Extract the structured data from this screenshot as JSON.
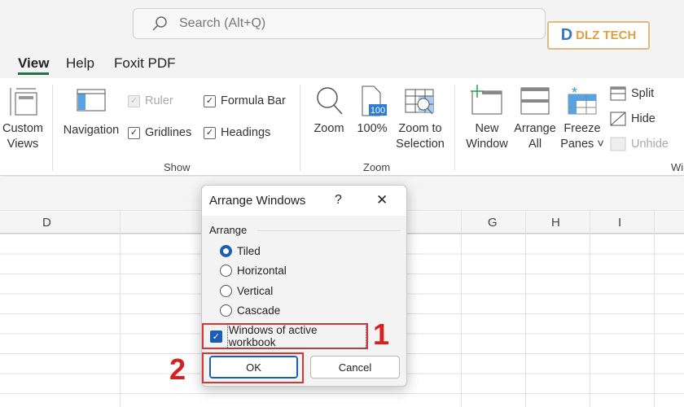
{
  "search": {
    "placeholder": "Search (Alt+Q)",
    "icon": "search-icon"
  },
  "logo": {
    "text": "DLZ TECH",
    "mark": "D"
  },
  "tabs": [
    {
      "label": "View",
      "active": true
    },
    {
      "label": "Help"
    },
    {
      "label": "Foxit PDF"
    }
  ],
  "ribbon": {
    "custom_views": [
      "Custom",
      "Views"
    ],
    "navigation": "Navigation",
    "show": {
      "ruler": "Ruler",
      "formula_bar": "Formula Bar",
      "gridlines": "Gridlines",
      "headings": "Headings",
      "group": "Show"
    },
    "zoom": {
      "zoom": "Zoom",
      "hundred": "100%",
      "hundred_badge": "100",
      "zoom_sel": [
        "Zoom to",
        "Selection"
      ],
      "group": "Zoom"
    },
    "window": {
      "new_window": [
        "New",
        "Window"
      ],
      "arrange_all": [
        "Arrange",
        "All"
      ],
      "freeze": [
        "Freeze",
        "Panes ˅"
      ],
      "split": "Split",
      "hide": "Hide",
      "unhide": "Unhide",
      "group": "Wi"
    }
  },
  "columns": [
    "D",
    "G",
    "H",
    "I"
  ],
  "dialog": {
    "title": "Arrange Windows",
    "help": "?",
    "close": "✕",
    "section": "Arrange",
    "options": [
      {
        "label": "Tiled",
        "checked": true
      },
      {
        "label": "Horizontal"
      },
      {
        "label": "Vertical"
      },
      {
        "label": "Cascade"
      }
    ],
    "checkbox": {
      "label": "Windows of active workbook",
      "checked": true
    },
    "ok": "OK",
    "cancel": "Cancel"
  },
  "annotations": [
    "1",
    "2"
  ],
  "colors": {
    "accent": "#217346",
    "annotation": "#d42020",
    "radio": "#1a5fb4"
  }
}
